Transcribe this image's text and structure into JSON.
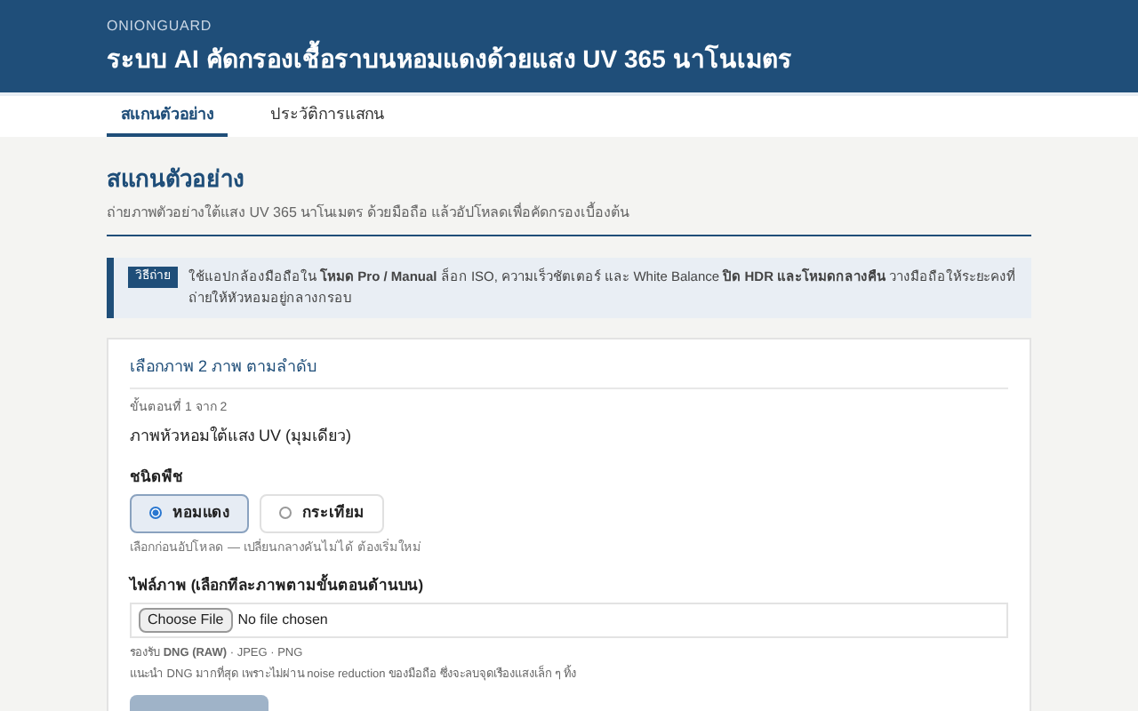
{
  "header": {
    "brand": "ONIONGUARD",
    "title": "ระบบ AI คัดกรองเชื้อราบนหอมแดงด้วยแสง UV 365 นาโนเมตร"
  },
  "tabs": [
    {
      "label": "สแกนตัวอย่าง",
      "selected": true
    },
    {
      "label": "ประวัติการแสกน",
      "selected": false
    }
  ],
  "section": {
    "title": "สแกนตัวอย่าง",
    "subtitle": "ถ่ายภาพตัวอย่างใต้แสง UV 365 นาโนเมตร ด้วยมือถือ แล้วอัปโหลดเพื่อคัดกรองเบื้องต้น"
  },
  "tip": {
    "badge": "วิธีถ่าย",
    "text": "ใช้แอปกล้องมือถือใน **โหมด Pro / Manual** ล็อก ISO, ความเร็วชัตเตอร์ และ White Balance **ปิด HDR และโหมดกลางคืน** วางมือถือให้ระยะคงที่ ถ่ายให้หัวหอมอยู่กลางกรอบ"
  },
  "card": {
    "title": "เลือกภาพ 2 ภาพ ตามลำดับ",
    "step": "ขั้นตอนที่ 1 จาก 2",
    "step_title": "ภาพหัวหอมใต้แสง UV (มุมเดียว)",
    "crop_label": "ชนิดพืช",
    "crops": [
      {
        "label": "หอมแดง",
        "selected": true
      },
      {
        "label": "กระเทียม",
        "selected": false
      }
    ],
    "crop_hint": "เลือกก่อนอัปโหลด — เปลี่ยนกลางคันไม่ได้ ต้องเริ่มใหม่",
    "file_label": "ไฟล์ภาพ (เลือกทีละภาพตามขั้นตอนด้านบน)",
    "file_button": "Choose File",
    "file_value": "No file chosen",
    "formats": "รองรับ **DNG (RAW)** · JPEG · PNG",
    "recommendation": "แนะนำ DNG มากที่สุด เพราะไม่ผ่าน noise reduction ของมือถือ ซึ่งจะลบจุดเรืองแสงเล็ก ๆ ทิ้ง",
    "submit": {
      "disabled": true
    }
  }
}
